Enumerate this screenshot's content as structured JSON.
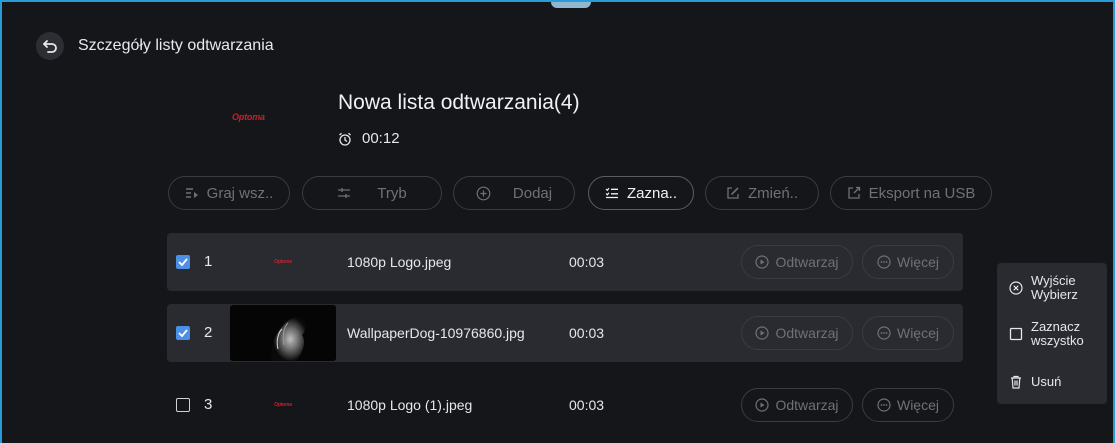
{
  "header": {
    "title": "Szczegóły listy odtwarzania",
    "back_icon": "back-arrow-icon"
  },
  "playlist": {
    "logo_text": "Optoma",
    "name": "Nowa lista odtwarzania(4)",
    "duration": "00:12"
  },
  "toolbar": {
    "play_all": "Graj wsz..",
    "mode": "Tryb",
    "add": "Dodaj",
    "select": "Zazna..",
    "rename": "Zmień..",
    "export": "Eksport na USB"
  },
  "rows": [
    {
      "index": "1",
      "checked": true,
      "thumb": "Optoma",
      "name": "1080p Logo.jpeg",
      "time": "00:03",
      "play": "Odtwarzaj",
      "more": "Więcej"
    },
    {
      "index": "2",
      "checked": true,
      "thumb": "",
      "name": "WallpaperDog-10976860.jpg",
      "time": "00:03",
      "play": "Odtwarzaj",
      "more": "Więcej"
    },
    {
      "index": "3",
      "checked": false,
      "thumb": "Optoma",
      "name": "1080p Logo (1).jpeg",
      "time": "00:03",
      "play": "Odtwarzaj",
      "more": "Więcej"
    }
  ],
  "menu": {
    "exit_line1": "Wyjście",
    "exit_line2": "Wybierz",
    "selectall_line1": "Zaznacz",
    "selectall_line2": "wszystko",
    "delete": "Usuń"
  },
  "colors": {
    "accent": "#4b8fe6",
    "frame": "#2b9ad9",
    "background": "#15161a",
    "selected_row": "#2a2b30",
    "logo_red": "#c8202a"
  }
}
